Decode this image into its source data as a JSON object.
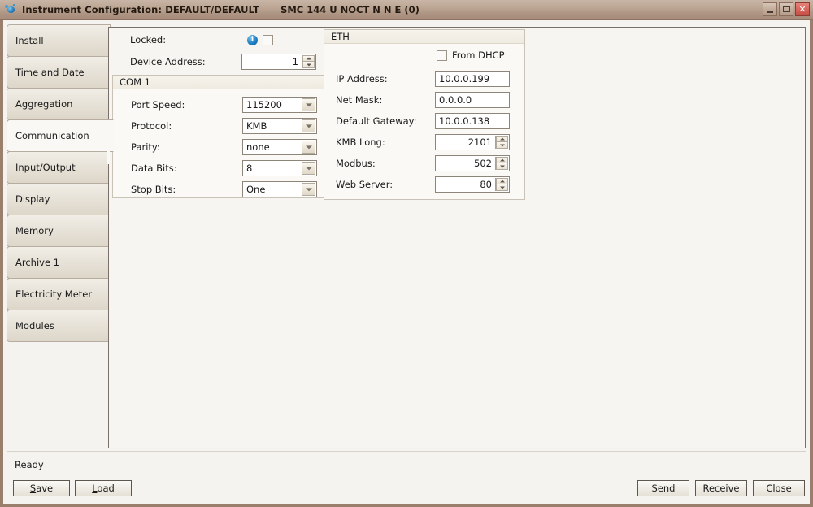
{
  "window": {
    "title": "Instrument Configuration: DEFAULT/DEFAULT",
    "subtitle": "SMC 144 U NOCT N N E (0)",
    "icon": "app-icon",
    "minimize_label": "",
    "maximize_label": "",
    "close_label": "✕",
    "titlebar_color": "#b59d8b",
    "accent_close_color": "#d8655c"
  },
  "sidebar": {
    "items": [
      {
        "label": "Install",
        "active": false
      },
      {
        "label": "Time and Date",
        "active": false
      },
      {
        "label": "Aggregation",
        "active": false
      },
      {
        "label": "Communication",
        "active": true
      },
      {
        "label": "Input/Output",
        "active": false
      },
      {
        "label": "Display",
        "active": false
      },
      {
        "label": "Memory",
        "active": false
      },
      {
        "label": "Archive 1",
        "active": false
      },
      {
        "label": "Electricity Meter",
        "active": false
      },
      {
        "label": "Modules",
        "active": false
      }
    ]
  },
  "main": {
    "locked": {
      "label": "Locked:",
      "info_icon": "info-icon",
      "checked": false
    },
    "device_address": {
      "label": "Device Address:",
      "value": "1"
    },
    "com1": {
      "title": "COM 1",
      "fields": [
        {
          "label": "Port Speed:",
          "value": "115200"
        },
        {
          "label": "Protocol:",
          "value": "KMB"
        },
        {
          "label": "Parity:",
          "value": "none"
        },
        {
          "label": "Data Bits:",
          "value": "8"
        },
        {
          "label": "Stop Bits:",
          "value": "One"
        }
      ]
    },
    "eth": {
      "title": "ETH",
      "from_dhcp": {
        "label": "From DHCP",
        "checked": false
      },
      "fields": [
        {
          "label": "IP Address:",
          "value": "10.0.0.199",
          "type": "text"
        },
        {
          "label": "Net Mask:",
          "value": "0.0.0.0",
          "type": "text"
        },
        {
          "label": "Default Gateway:",
          "value": "10.0.0.138",
          "type": "text"
        },
        {
          "label": "KMB Long:",
          "value": "2101",
          "type": "spinner"
        },
        {
          "label": "Modbus:",
          "value": "502",
          "type": "spinner"
        },
        {
          "label": "Web Server:",
          "value": "80",
          "type": "spinner"
        }
      ]
    }
  },
  "statusbar": {
    "status": "Ready",
    "save_label": "Save",
    "save_mnemonic": "S",
    "load_label": "Load",
    "load_mnemonic": "L",
    "send_label": "Send",
    "receive_label": "Receive",
    "close_label": "Close"
  }
}
